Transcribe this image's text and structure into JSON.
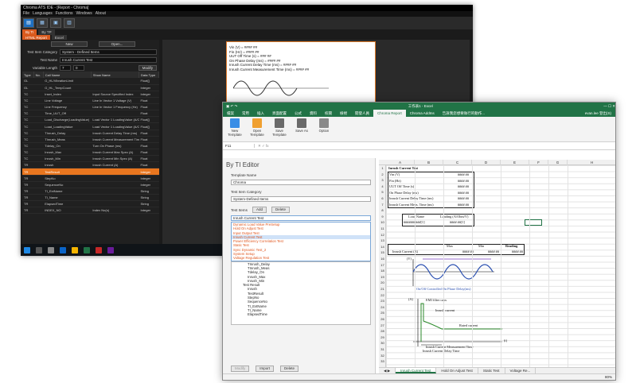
{
  "ats": {
    "title": "Chroma ATS IDE - [Report - Chroma]",
    "menu": [
      "File",
      "Languages",
      "Functions",
      "Windows",
      "About"
    ],
    "doctabs": [
      "By TI",
      "By TP"
    ],
    "subtabs": [
      "HTML Report",
      "Excel"
    ],
    "new_label": "New",
    "open_label": "Open...",
    "test_item_category_label": "Test Item Category",
    "test_item_category_value": "System - Defined Items",
    "test_name_label": "Test Name",
    "test_name_value": "Inrush Current Test",
    "variable_length_label": "Variable Length",
    "variable_length_a": "7",
    "variable_length_b": "0",
    "modify_label": "Modify",
    "table": {
      "headers": [
        "Type",
        "No.",
        "Call Name",
        "Show Name",
        "Data Type"
      ],
      "rows": [
        [
          "GL",
          "",
          "G_HL/VibrationLimit",
          "",
          "Float[]"
        ],
        [
          "GL",
          "",
          "G_HL_TempCount",
          "",
          "Integer"
        ],
        [
          "TC",
          "",
          "Inset_Index",
          "Input Source Specified Index",
          "Integer"
        ],
        [
          "TC",
          "",
          "Line Voltage",
          "Line In Vector 1 Voltage (V)",
          "Float"
        ],
        [
          "TC",
          "",
          "Line Frequency",
          "Line In Vector 1 Frequency (Hz)",
          "Float"
        ],
        [
          "TC",
          "",
          "Time_UUT_Off",
          "",
          "Float"
        ],
        [
          "TC",
          "",
          "Load_Discharge(LoadingValue)",
          "Load Vector 1 LoadingValue (A/C",
          "Float[]"
        ],
        [
          "TC",
          "",
          "Load_LoadingValue",
          "Load Vector 1 LoadingValue (A/C",
          "Float[]"
        ],
        [
          "TC",
          "",
          "TInrush_Delay",
          "Inrush Current Delay Time (ms)",
          "Float"
        ],
        [
          "TC",
          "",
          "TInrush_Meas",
          "Inrush Current Measurement Time",
          "Float"
        ],
        [
          "TC",
          "",
          "Tdelay_On",
          "Turn On Phase (ms)",
          "Float"
        ],
        [
          "TC",
          "",
          "Inrush_Max",
          "Inrush Current Max Spec (A)",
          "Float"
        ],
        [
          "TC",
          "",
          "Inrush_Min",
          "Inrush Current Min Spec (A)",
          "Float"
        ],
        [
          "TR",
          "",
          "Inrush",
          "Inrush Current (A)",
          "Float"
        ],
        [
          "TR",
          "",
          "TestResult",
          "",
          "Integer"
        ],
        [
          "TR",
          "",
          "StepNo",
          "",
          "Integer"
        ],
        [
          "TR",
          "",
          "SequenceNo",
          "",
          "Integer"
        ],
        [
          "TR",
          "",
          "TI_ExtName",
          "",
          "String"
        ],
        [
          "TR",
          "",
          "TI_Name",
          "",
          "String"
        ],
        [
          "TR",
          "",
          "ElapsedTime",
          "",
          "String"
        ],
        [
          "TR",
          "",
          "INDEX_NO",
          "Index No(s)",
          "Integer"
        ]
      ],
      "selected_row": 14
    },
    "report_lines": [
      "Vin (V) =      #### ##",
      "Fin (Hz) =     #### ##",
      "UUT Off Time (s) = ### ##",
      "On Phase Delay (ms) = #### ##",
      "Inrush Current Delay Time (ms) = #### ##",
      "Inrush Current Measurement Time (ms) = #### ##"
    ]
  },
  "excel": {
    "title": "工作表1 - Excel",
    "user": "evan.lee 登出(S)",
    "tabs": [
      "檔案",
      "常用",
      "插入",
      "頁面配置",
      "公式",
      "資料",
      "校閱",
      "檢視",
      "開發人員",
      "Chroma Report",
      "Chroma AddIns",
      "告訴我您想要執行的動作..."
    ],
    "active_tab": 9,
    "ribbon": [
      {
        "label": "New Template",
        "color": "#3a8ee6"
      },
      {
        "label": "Open Template",
        "color": "#f0a030"
      },
      {
        "label": "Save Template",
        "color": "#6a6a6a"
      },
      {
        "label": "Save As",
        "color": "#6a6a6a"
      },
      {
        "label": "Option",
        "color": "#8a8a8a"
      }
    ],
    "namebox": "F11",
    "pane": {
      "title": "By TI Editor",
      "template_name_label": "Template Name",
      "template_name_value": "Chroma",
      "category_label": "Test Item Category",
      "category_value": "System-Defined Items",
      "test_items_label": "Test Items",
      "add_label": "Add",
      "delete_label": "Delete",
      "current_item": "Inrush Current Test",
      "dropdown_items": [
        "Dynamic Load Value PreSetup",
        "Hold On Adjust Test",
        "Input Output Test",
        "Inrush Current Test",
        "Power Efficiency Correlation Test",
        "Static Test",
        "Sync Dynamic Test_2",
        "System Setup",
        "Voltage Regulation Test"
      ],
      "dropdown_selected": 3,
      "tree_items": [
        "TInrush_Delay",
        "TInrush_Meas",
        "Tdelay_On",
        "Inrush_Max",
        "Inrush_Min",
        "Test Result",
        "Inrush",
        "TestResult",
        "StepNo",
        "SequenceNo",
        "TI_ExtName",
        "TI_Name",
        "ElapsedTime"
      ],
      "modify_label": "Modify",
      "import_label": "Import",
      "delete2_label": "Delete"
    },
    "columns": [
      "A",
      "B",
      "C",
      "D",
      "E",
      "F",
      "G",
      "H"
    ],
    "rows": [
      "1",
      "2",
      "3",
      "4",
      "5",
      "6",
      "7",
      "8",
      "9",
      "10",
      "11",
      "12",
      "13",
      "14",
      "15",
      "16",
      "17",
      "18",
      "19",
      "20",
      "21",
      "22",
      "23",
      "24",
      "25",
      "26",
      "27",
      "28",
      "29",
      "30",
      "31",
      "32",
      "33"
    ],
    "sheet": {
      "heading": "Inrush Current Test",
      "params": [
        {
          "name": "Vin (V)",
          "value": "#### ##"
        },
        {
          "name": "Fin (Hz)",
          "value": "#### ##"
        },
        {
          "name": "UUT Off Time (s)",
          "value": "#### ##"
        },
        {
          "name": "On Phase Delay (ms)",
          "value": "#### ##"
        },
        {
          "name": "Inrush Current Delay Time (ms)",
          "value": "#### ##"
        },
        {
          "name": "Inrush Current Meas. Time (ms)",
          "value": "#### ##"
        }
      ],
      "load_name_header": "Load Name",
      "loading_header": "Loading (A/Ohm/V)",
      "load_row": "##########[1]",
      "load_row_value": "#### ##[1]",
      "max_header": "Max",
      "min_header": "Min",
      "reading_header": "Reading",
      "inrush_label": "Inrush Current (A)",
      "inrush_max": "#### ##",
      "inrush_min": "#### ##",
      "inrush_reading": "#### ##",
      "wave_label": "On/Off Controlled On Phase Delay(ms)",
      "diag_emi": "EMI filter caps",
      "diag_inrush": "Inrush current",
      "diag_rated": "Rated current",
      "diag_meas": "Inrush Current Measurement Time",
      "diag_delay": "Inrush Current Delay Time",
      "diag_v": "(V)",
      "diag_a": "(A)",
      "diag_t": "(t)"
    },
    "sheet_tabs": [
      "Inrush Current Test",
      "Hold On Adjust Test",
      "Static Test",
      "Voltage Re..."
    ],
    "active_sheet": 0,
    "zoom": "80%"
  }
}
